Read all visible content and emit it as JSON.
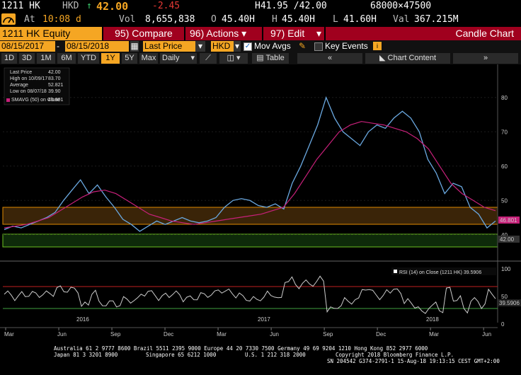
{
  "quote": {
    "ticker": "1211 HK",
    "currency": "HKD",
    "arrow": "↑",
    "last": "42.00",
    "change": "-2.45",
    "high_low": "H41.95 /42.00",
    "bid_ask_size": "68000×47500",
    "at_label": "At",
    "time": "10:08 d",
    "vol_label": "Vol",
    "volume": "8,655,838",
    "open_label": "O",
    "open": "45.40H",
    "high_label": "H",
    "high": "45.40H",
    "low_label": "L",
    "low": "41.60H",
    "val_label": "Val",
    "value": "367.215M"
  },
  "menu": {
    "security": "1211 HK Equity",
    "compare": "95) Compare",
    "actions": "96) Actions",
    "edit": "97) Edit",
    "title": "Candle Chart"
  },
  "toolbar": {
    "start_date": "08/15/2017",
    "end_date": "08/15/2018",
    "field": "Last Price",
    "currency": "HKD",
    "mov_avgs": "Mov Avgs",
    "key_events": "Key Events",
    "chart_content": "Chart Content"
  },
  "periods": [
    "1D",
    "3D",
    "1M",
    "6M",
    "YTD",
    "1Y",
    "5Y",
    "Max"
  ],
  "frequency": "Daily",
  "table_label": "Table",
  "legend": {
    "rows": [
      {
        "label": "Last Price",
        "value": "42.00"
      },
      {
        "label": "High on 10/09/17",
        "value": "83.70"
      },
      {
        "label": "Average",
        "value": "52.821"
      },
      {
        "label": "Low on 08/07/18",
        "value": "39.90"
      },
      {
        "label": "SMAVG (50) on Close",
        "value": "46.801"
      }
    ],
    "rsi": "RSI (14) on Close (1211 HK) 39.5906"
  },
  "axis": {
    "price_ticks": [
      "80",
      "70",
      "60",
      "50",
      "40"
    ],
    "rsi_ticks": [
      "100",
      "50",
      "0"
    ],
    "last_tag": "42.00",
    "sma_tag": "46.801",
    "rsi_tag": "39.5906",
    "x_months": [
      "Mar",
      "Jun",
      "Sep",
      "Dec",
      "Mar",
      "Jun",
      "Sep",
      "Dec",
      "Mar",
      "Jun"
    ],
    "x_years": [
      "2016",
      "2017",
      "2018"
    ]
  },
  "footer": {
    "line1": "Australia 61 2 9777 8600 Brazil 5511 2395 9000 Europe 44 20 7330 7500 Germany 49 69 9204 1210 Hong Kong 852 2977 6000",
    "line2a": "Japan 81 3 3201 8900",
    "line2b": "Singapore 65 6212 1000",
    "line2c": "U.S. 1 212 318 2000",
    "line2d": "Copyright 2018 Bloomberg Finance L.P.",
    "line3": "SN 204542 G374-2791-1 15-Aug-18 19:13:15 CEST GMT+2:00"
  },
  "colors": {
    "orange": "#f5a623",
    "red_menu": "#a0001e",
    "green_text": "#3cd070",
    "price_line": "#6aa8e0",
    "sma": "#c8207a",
    "band_orange": "#3a2408",
    "band_green": "#0e2a0a"
  },
  "chart_data": {
    "type": "line",
    "ylim": [
      35,
      88
    ],
    "x": [
      0,
      4,
      8,
      12,
      16,
      20,
      24,
      28,
      32,
      36,
      40,
      44,
      48,
      52,
      56,
      60,
      64,
      68,
      72,
      76,
      80,
      84,
      88,
      90,
      92,
      94,
      98,
      102,
      106,
      110,
      114,
      118,
      122,
      126,
      130,
      134,
      138,
      142,
      146,
      150,
      154,
      158,
      162,
      164
    ],
    "series": [
      {
        "values": [
          41.5,
          42.5,
          42,
          43,
          44,
          45,
          46.5,
          50,
          53,
          56,
          52,
          54.5,
          51,
          48,
          44.5,
          43,
          41,
          42.5,
          44,
          43,
          44,
          45,
          44,
          43.5,
          44,
          45,
          48,
          50,
          50.5,
          50,
          48.5,
          48,
          49,
          47.5,
          55,
          60,
          66,
          72,
          80,
          74,
          70,
          68,
          66,
          70,
          72,
          71,
          74,
          76,
          74,
          70,
          62,
          58,
          52,
          55,
          54,
          48,
          46,
          42,
          44
        ]
      },
      {
        "values": [
          42,
          42.5,
          43,
          44,
          45,
          47,
          49,
          51,
          52.5,
          53,
          52,
          50,
          48,
          46,
          45,
          44,
          43.5,
          43,
          43.5,
          44,
          44.5,
          45,
          45.5,
          46,
          47,
          48,
          52,
          57,
          62,
          66,
          70,
          72,
          73,
          72.5,
          72,
          71,
          70,
          68,
          65,
          60,
          55,
          52,
          50,
          48,
          47
        ]
      }
    ]
  }
}
